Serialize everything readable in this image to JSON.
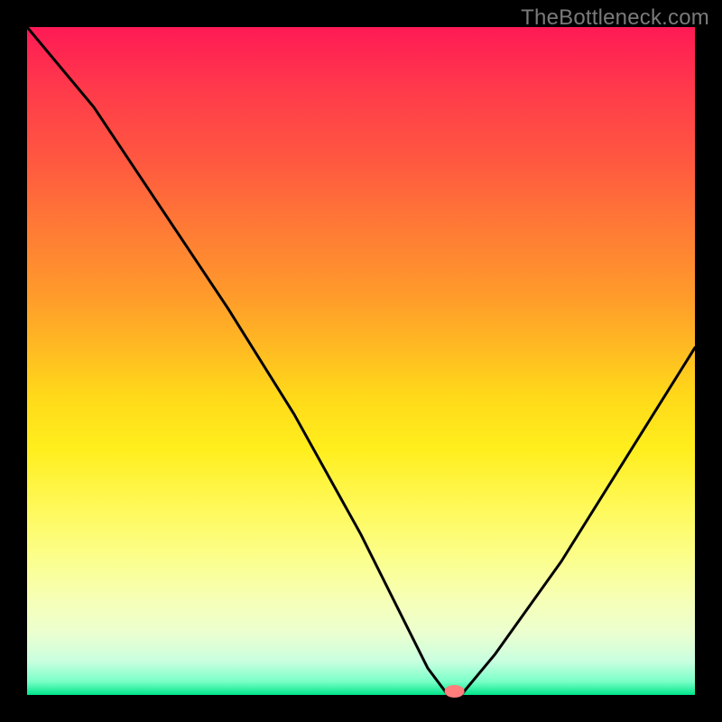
{
  "watermark": "TheBottleneck.com",
  "chart_data": {
    "type": "line",
    "title": "",
    "xlabel": "",
    "ylabel": "",
    "xlim": [
      0,
      100
    ],
    "ylim": [
      0,
      100
    ],
    "grid": false,
    "legend": false,
    "background": "rainbow-gradient-red-to-green",
    "series": [
      {
        "name": "bottleneck-curve",
        "x": [
          0,
          10,
          20,
          30,
          40,
          50,
          55,
          60,
          63,
          65,
          70,
          80,
          90,
          100
        ],
        "y": [
          100,
          88,
          73,
          58,
          42,
          24,
          14,
          4,
          0,
          0,
          6,
          20,
          36,
          52
        ]
      }
    ],
    "marker": {
      "x": 64,
      "y": 0,
      "color": "#ff7d7d"
    }
  },
  "colors": {
    "frame": "#000000",
    "curve": "#000000",
    "marker": "#ff7d7d",
    "watermark": "#7a7a7a"
  }
}
